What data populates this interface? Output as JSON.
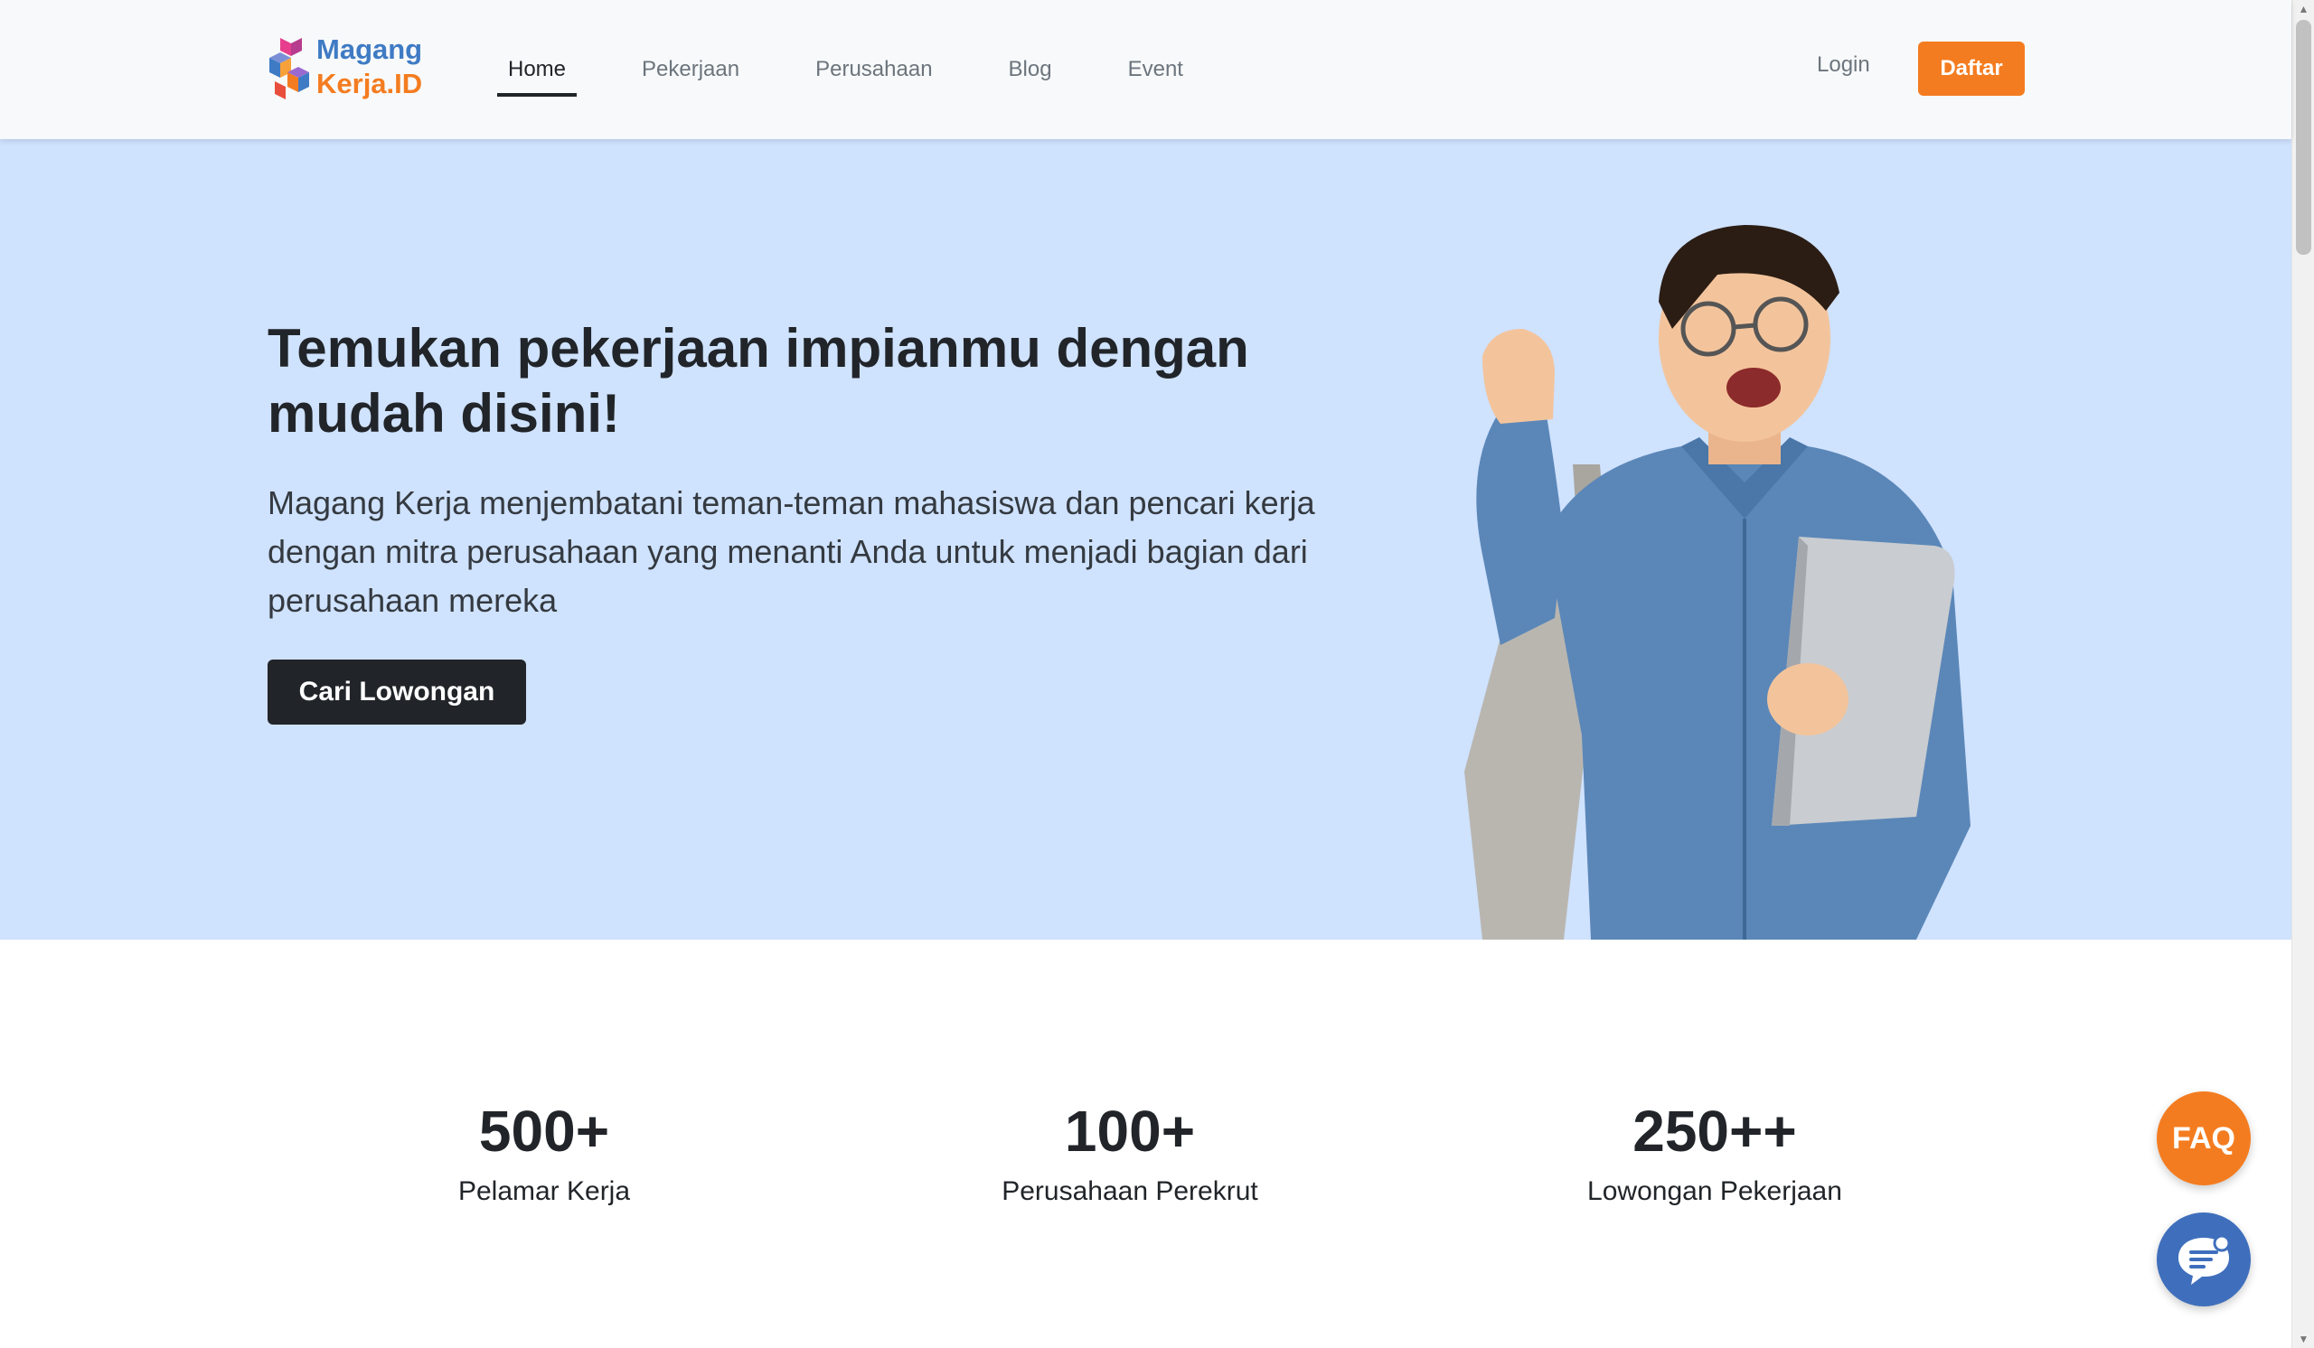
{
  "brand": {
    "line1": "Magang",
    "line2": "Kerja.ID",
    "colors": {
      "blue": "#3f7bc4",
      "orange": "#f47c20",
      "pink": "#e63e8c"
    }
  },
  "nav": {
    "links": [
      {
        "label": "Home",
        "active": true
      },
      {
        "label": "Pekerjaan",
        "active": false
      },
      {
        "label": "Perusahaan",
        "active": false
      },
      {
        "label": "Blog",
        "active": false
      },
      {
        "label": "Event",
        "active": false
      }
    ],
    "login": "Login",
    "register": "Daftar"
  },
  "hero": {
    "title": "Temukan pekerjaan impianmu dengan mudah disini!",
    "description": "Magang Kerja menjembatani teman-teman mahasiswa dan pencari kerja dengan mitra perusahaan yang menanti Anda untuk menjadi bagian dari perusahaan mereka",
    "cta": "Cari Lowongan",
    "background": "#cfe2fe"
  },
  "stats": [
    {
      "value": "500+",
      "label": "Pelamar Kerja"
    },
    {
      "value": "100+",
      "label": "Perusahaan Perekrut"
    },
    {
      "value": "250++",
      "label": "Lowongan Pekerjaan"
    }
  ],
  "floating": {
    "faq": "FAQ",
    "chat_icon": "chat-bubble-icon"
  },
  "colors": {
    "accent": "#f47c20",
    "dark": "#212529",
    "chat": "#3f6fbc"
  }
}
